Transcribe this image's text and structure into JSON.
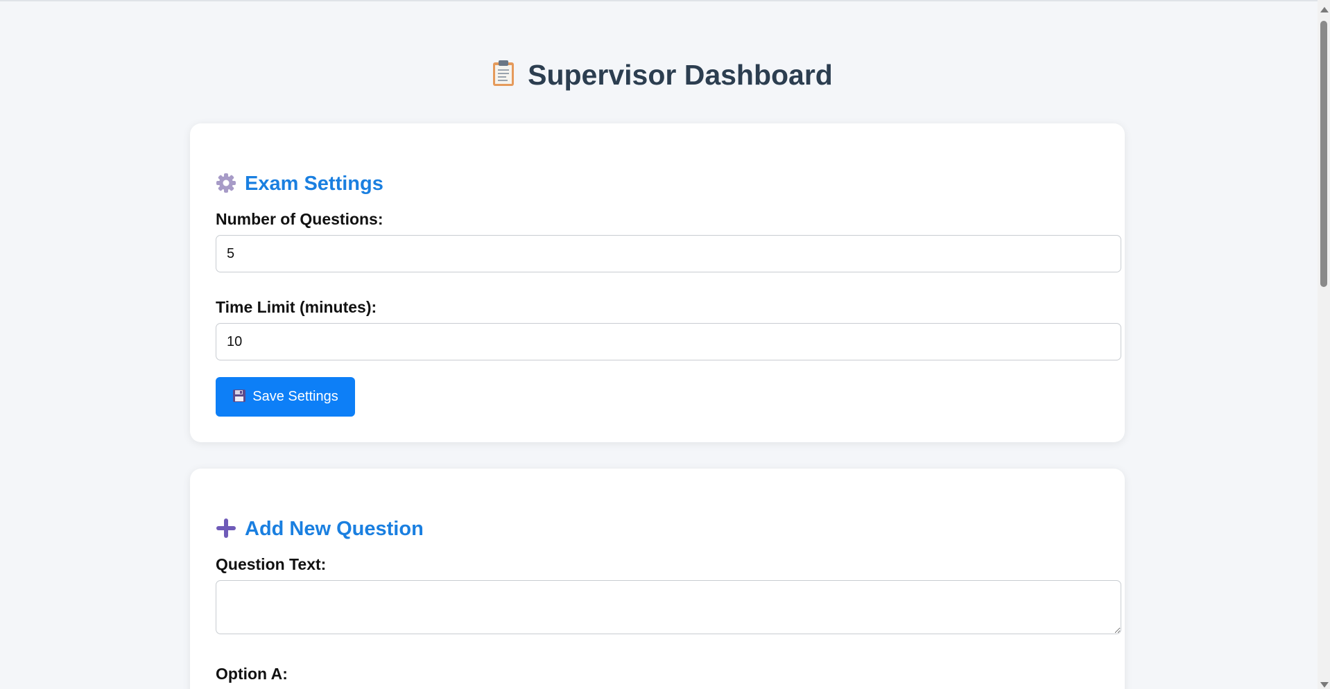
{
  "page": {
    "title": "Supervisor Dashboard",
    "title_icon": "clipboard-icon"
  },
  "settings": {
    "heading": "Exam Settings",
    "heading_icon": "gear-icon",
    "num_questions_label": "Number of Questions:",
    "num_questions_value": "5",
    "time_limit_label": "Time Limit (minutes):",
    "time_limit_value": "10",
    "save_label": "Save Settings",
    "save_icon": "floppy-disk-icon"
  },
  "question": {
    "heading": "Add New Question",
    "heading_icon": "plus-icon",
    "question_text_label": "Question Text:",
    "question_text_value": "",
    "option_a_label": "Option A:"
  },
  "colors": {
    "accent": "#1a7fe0",
    "button": "#0d7ff7",
    "title": "#2c3e50",
    "background": "#f4f6f9"
  }
}
